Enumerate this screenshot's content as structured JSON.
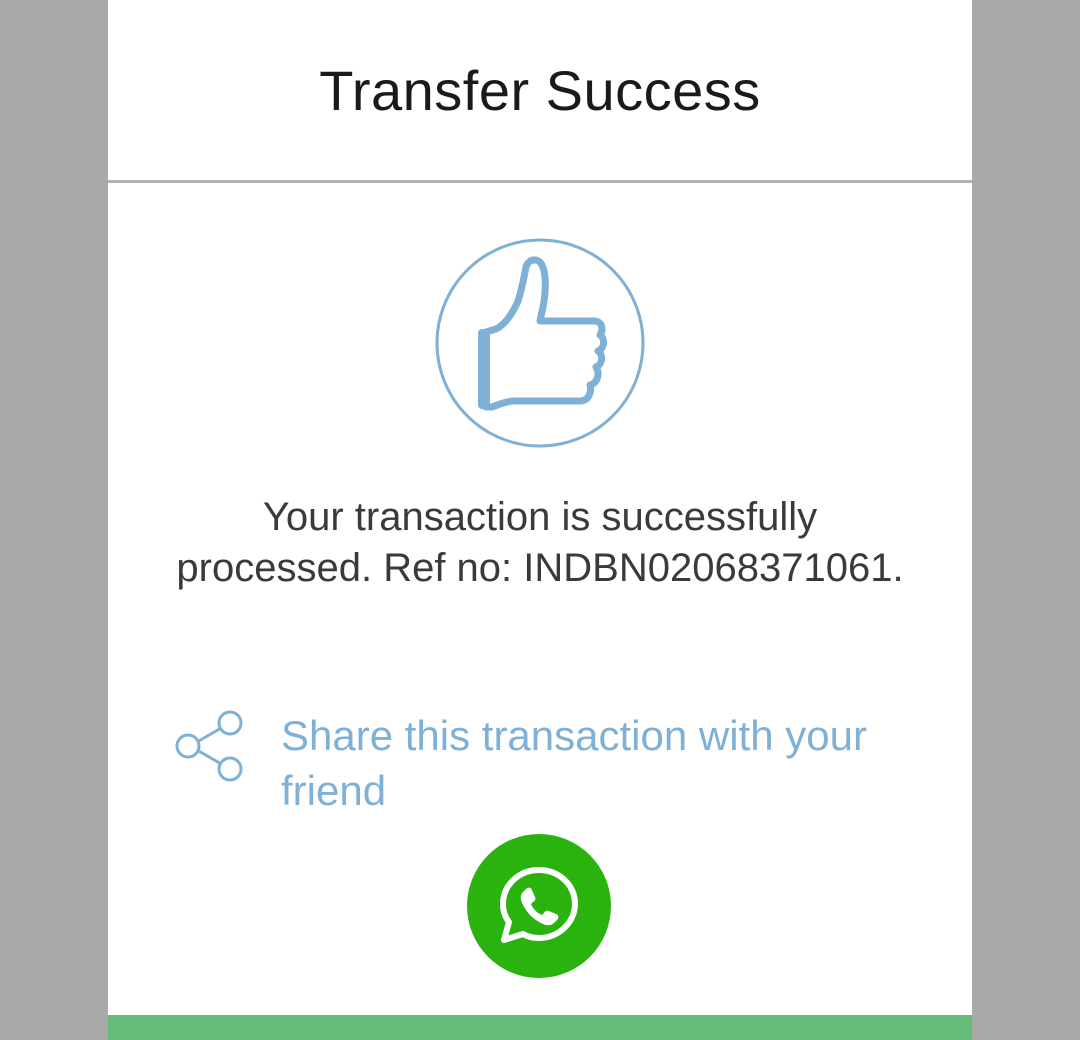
{
  "dialog": {
    "title": "Transfer Success",
    "message": "Your transaction is successfully processed. Ref no: INDBN02068371061.",
    "share": {
      "label": "Share this transaction with your friend",
      "icon": "share-icon"
    },
    "success_icon": "thumbs-up-icon",
    "whatsapp_icon": "whatsapp-icon"
  },
  "colors": {
    "backdrop": "#a9a9a9",
    "accent_blue": "#7fb0d6",
    "whatsapp_green": "#2ab20f",
    "footer_green": "#66bd79"
  }
}
